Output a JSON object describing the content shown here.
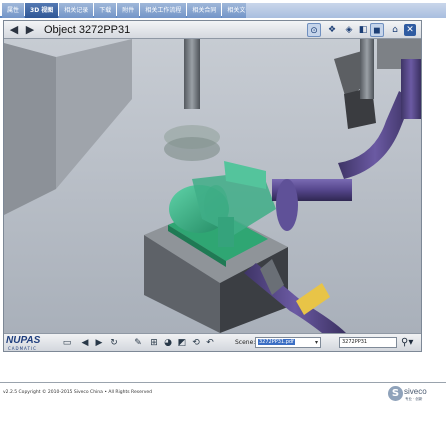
{
  "tabs": [
    {
      "label": "属性",
      "active": false
    },
    {
      "label": "3D 视图",
      "active": true
    },
    {
      "label": "相关记录",
      "active": false
    },
    {
      "label": "下载",
      "active": false
    },
    {
      "label": "附件",
      "active": false
    },
    {
      "label": "相关工作流程",
      "active": false
    },
    {
      "label": "相关合同",
      "active": false
    },
    {
      "label": "相关文件",
      "active": false
    }
  ],
  "viewer": {
    "title": "Object 3272PP31",
    "nav": {
      "back_icon": "left-arrow-icon",
      "forward_icon": "right-arrow-icon"
    },
    "tools": [
      {
        "name": "view-all-icon",
        "selected": true
      },
      {
        "name": "show-neighbors-icon",
        "selected": false
      },
      {
        "name": "wireframe-icon",
        "selected": false
      },
      {
        "name": "selection-icon",
        "selected": false
      },
      {
        "name": "isolate-icon",
        "selected": true
      },
      {
        "name": "home-icon",
        "selected": false
      }
    ],
    "close_icon": "close-icon"
  },
  "bottombar": {
    "logo": {
      "name": "NUPAS",
      "sub": "CADMATIC"
    },
    "scene_label": "Scene:",
    "scene_value": "3272PP31.pdf",
    "find_value": "3272PP31",
    "search_icon": "search-icon"
  },
  "footer": {
    "copyright": "v2.2.5 Copyright © 2010-2015 Siveco China • All Rights Reserved",
    "brand": "siveco",
    "brand_tag": "专业 · 创新"
  },
  "colors": {
    "tab_active": "#2f5796",
    "tab": "#7395c8",
    "pump": "#3fae87",
    "pipe_purple": "#5a4a8c",
    "brand_blue": "#1f3e7d"
  }
}
